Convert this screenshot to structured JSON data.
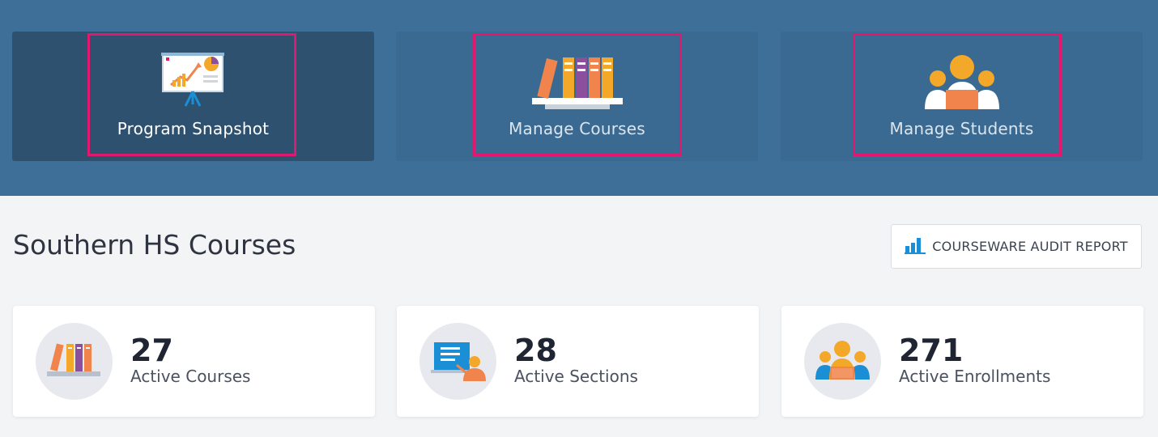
{
  "nav": {
    "cards": [
      {
        "label": "Program Snapshot",
        "icon": "presentation-chart-icon",
        "active": true
      },
      {
        "label": "Manage Courses",
        "icon": "books-icon",
        "active": false
      },
      {
        "label": "Manage Students",
        "icon": "students-group-icon",
        "active": false
      }
    ]
  },
  "main": {
    "title": "Southern HS Courses",
    "audit_button": {
      "label": "COURSEWARE AUDIT REPORT",
      "icon": "bar-chart-icon"
    }
  },
  "stats": [
    {
      "value": "27",
      "label": "Active Courses",
      "icon": "books-icon"
    },
    {
      "value": "28",
      "label": "Active Sections",
      "icon": "teacher-board-icon"
    },
    {
      "value": "271",
      "label": "Active Enrollments",
      "icon": "students-group-icon"
    }
  ],
  "colors": {
    "header_bg": "#3d6f98",
    "highlight": "#e0196e",
    "accent_blue": "#1a8fd6",
    "orange": "#f0844c",
    "yellow": "#f3a829",
    "purple": "#8b4f9e"
  }
}
